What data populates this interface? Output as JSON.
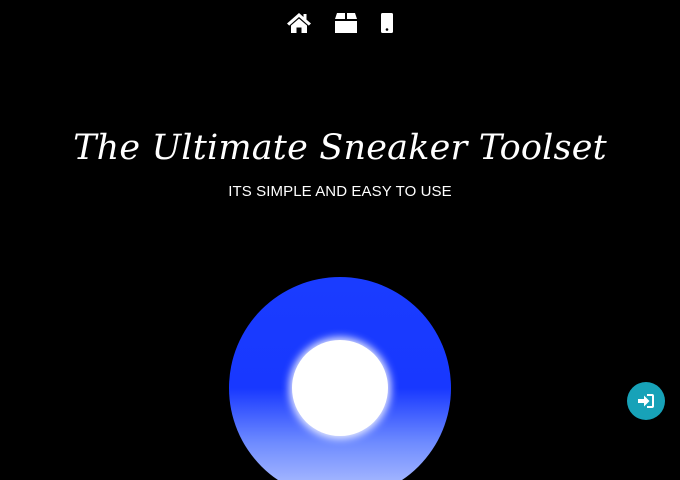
{
  "nav": {
    "items": [
      {
        "icon": "home-icon"
      },
      {
        "icon": "box-icon"
      },
      {
        "icon": "mobile-phone-icon"
      }
    ]
  },
  "hero": {
    "title": "The Ultimate Sneaker Toolset",
    "subtitle": "ITS SIMPLE AND EASY TO USE"
  },
  "login_button": {
    "icon": "sign-in-icon",
    "color": "#17a2b8"
  },
  "colors": {
    "background": "#000000",
    "orb_top": "#1a3cff",
    "orb_bottom": "#b8c6ff",
    "text": "#ffffff"
  }
}
